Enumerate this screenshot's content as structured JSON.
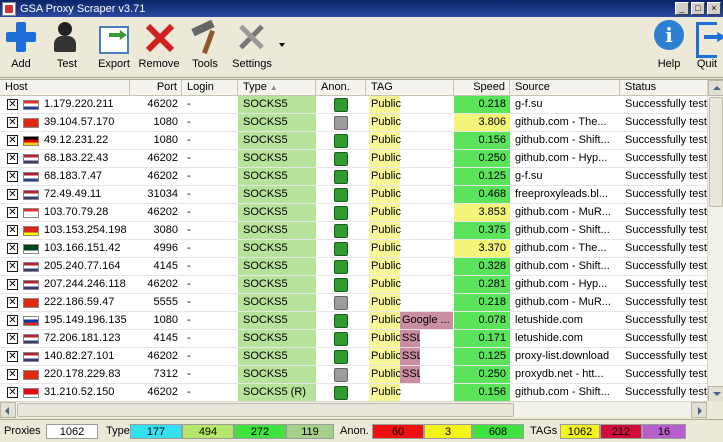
{
  "window": {
    "title": "GSA Proxy Scraper v3.71",
    "buttons": [
      "_",
      "□",
      "×"
    ]
  },
  "toolbar": {
    "add": "Add",
    "test": "Test",
    "export": "Export",
    "remove": "Remove",
    "tools": "Tools",
    "settings": "Settings",
    "help": "Help",
    "quit": "Quit",
    "help_glyph": "i"
  },
  "columns": [
    "Host",
    "Port",
    "Login",
    "Type",
    "Anon.",
    "TAG",
    "Speed",
    "Source",
    "Status"
  ],
  "rows": [
    {
      "flag": [
        "#e03030",
        "#ffffff",
        "#2040a0"
      ],
      "host": "1.179.220.211",
      "port": "46202",
      "login": "-",
      "type": "SOCKS5",
      "anon": "green",
      "tag": "Public",
      "tag2": "",
      "speed": "0.218",
      "speed_color": "#5be35b",
      "source": "g-f.su",
      "status": "Successfully teste"
    },
    {
      "flag": [
        "#de2910",
        "#de2910",
        "#de2910"
      ],
      "host": "39.104.57.170",
      "port": "1080",
      "login": "-",
      "type": "SOCKS5",
      "anon": "gray",
      "tag": "Public",
      "tag2": "",
      "speed": "3.806",
      "speed_color": "#f5f57a",
      "source": "github.com - The...",
      "status": "Successfully teste"
    },
    {
      "flag": [
        "#000000",
        "#dd0000",
        "#ffce00"
      ],
      "host": "49.12.231.22",
      "port": "1080",
      "login": "-",
      "type": "SOCKS5",
      "anon": "green",
      "tag": "Public",
      "tag2": "",
      "speed": "0.156",
      "speed_color": "#5be35b",
      "source": "github.com - Shift...",
      "status": "Successfully teste"
    },
    {
      "flag": [
        "#b22234",
        "#ffffff",
        "#3c3b6e"
      ],
      "host": "68.183.22.43",
      "port": "46202",
      "login": "-",
      "type": "SOCKS5",
      "anon": "green",
      "tag": "Public",
      "tag2": "",
      "speed": "0.250",
      "speed_color": "#5be35b",
      "source": "github.com - Hyp...",
      "status": "Successfully teste"
    },
    {
      "flag": [
        "#ae1c28",
        "#ffffff",
        "#21468b"
      ],
      "host": "68.183.7.47",
      "port": "46202",
      "login": "-",
      "type": "SOCKS5",
      "anon": "green",
      "tag": "Public",
      "tag2": "",
      "speed": "0.125",
      "speed_color": "#5be35b",
      "source": "g-f.su",
      "status": "Successfully teste"
    },
    {
      "flag": [
        "#b22234",
        "#ffffff",
        "#3c3b6e"
      ],
      "host": "72.49.49.11",
      "port": "31034",
      "login": "-",
      "type": "SOCKS5",
      "anon": "green",
      "tag": "Public",
      "tag2": "",
      "speed": "0.468",
      "speed_color": "#5be35b",
      "source": "freeproxyleads.bl...",
      "status": "Successfully teste"
    },
    {
      "flag": [
        "#e03030",
        "#ffffff",
        "#ffffff"
      ],
      "host": "103.70.79.28",
      "port": "46202",
      "login": "-",
      "type": "SOCKS5",
      "anon": "green",
      "tag": "Public",
      "tag2": "",
      "speed": "3.853",
      "speed_color": "#f5f57a",
      "source": "github.com - MuR...",
      "status": "Successfully teste"
    },
    {
      "flag": [
        "#da251d",
        "#da251d",
        "#ffff00"
      ],
      "host": "103.153.254.198",
      "port": "3080",
      "login": "-",
      "type": "SOCKS5",
      "anon": "green",
      "tag": "Public",
      "tag2": "",
      "speed": "0.375",
      "speed_color": "#5be35b",
      "source": "github.com - Shift...",
      "status": "Successfully teste"
    },
    {
      "flag": [
        "#01411c",
        "#01411c",
        "#ffffff"
      ],
      "host": "103.166.151.42",
      "port": "4996",
      "login": "-",
      "type": "SOCKS5",
      "anon": "green",
      "tag": "Public",
      "tag2": "",
      "speed": "3.370",
      "speed_color": "#f5f57a",
      "source": "github.com - The...",
      "status": "Successfully teste"
    },
    {
      "flag": [
        "#b22234",
        "#ffffff",
        "#3c3b6e"
      ],
      "host": "205.240.77.164",
      "port": "4145",
      "login": "-",
      "type": "SOCKS5",
      "anon": "green",
      "tag": "Public",
      "tag2": "",
      "speed": "0.328",
      "speed_color": "#5be35b",
      "source": "github.com - Shift...",
      "status": "Successfully teste"
    },
    {
      "flag": [
        "#b22234",
        "#ffffff",
        "#3c3b6e"
      ],
      "host": "207.244.246.118",
      "port": "46202",
      "login": "-",
      "type": "SOCKS5",
      "anon": "green",
      "tag": "Public",
      "tag2": "",
      "speed": "0.281",
      "speed_color": "#5be35b",
      "source": "github.com - Hyp...",
      "status": "Successfully teste"
    },
    {
      "flag": [
        "#de2910",
        "#de2910",
        "#de2910"
      ],
      "host": "222.186.59.47",
      "port": "5555",
      "login": "-",
      "type": "SOCKS5",
      "anon": "gray",
      "tag": "Public",
      "tag2": "",
      "speed": "0.218",
      "speed_color": "#5be35b",
      "source": "github.com - MuR...",
      "status": "Successfully teste"
    },
    {
      "flag": [
        "#ffffff",
        "#0039a6",
        "#d52b1e"
      ],
      "host": "195.149.196.135",
      "port": "1080",
      "login": "-",
      "type": "SOCKS5",
      "anon": "green",
      "tag": "Public",
      "tag2": "Google ...",
      "speed": "0.078",
      "speed_color": "#5be35b",
      "source": "letushide.com",
      "status": "Successfully teste"
    },
    {
      "flag": [
        "#b22234",
        "#ffffff",
        "#3c3b6e"
      ],
      "host": "72.206.181.123",
      "port": "4145",
      "login": "-",
      "type": "SOCKS5",
      "anon": "green",
      "tag": "Public",
      "tag2": "SSL",
      "speed": "0.171",
      "speed_color": "#5be35b",
      "source": "letushide.com",
      "status": "Successfully teste"
    },
    {
      "flag": [
        "#b22234",
        "#ffffff",
        "#3c3b6e"
      ],
      "host": "140.82.27.101",
      "port": "46202",
      "login": "-",
      "type": "SOCKS5",
      "anon": "green",
      "tag": "Public",
      "tag2": "SSL",
      "speed": "0.125",
      "speed_color": "#5be35b",
      "source": "proxy-list.download",
      "status": "Successfully teste"
    },
    {
      "flag": [
        "#de2910",
        "#de2910",
        "#de2910"
      ],
      "host": "220.178.229.83",
      "port": "7312",
      "login": "-",
      "type": "SOCKS5",
      "anon": "gray",
      "tag": "Public",
      "tag2": "SSL",
      "speed": "0.250",
      "speed_color": "#5be35b",
      "source": "proxydb.net - htt...",
      "status": "Successfully teste"
    },
    {
      "flag": [
        "#e30a17",
        "#e30a17",
        "#ffffff"
      ],
      "host": "31.210.52.150",
      "port": "46202",
      "login": "-",
      "type": "SOCKS5 (R)",
      "anon": "green",
      "tag": "Public",
      "tag2": "",
      "speed": "0.156",
      "speed_color": "#5be35b",
      "source": "github.com - Shift...",
      "status": "Successfully teste"
    }
  ],
  "status": {
    "proxies_label": "Proxies",
    "proxies_count": "1062",
    "type_label": "Type",
    "type_counts": [
      {
        "value": "177",
        "color": "#33e0f0"
      },
      {
        "value": "494",
        "color": "#b5e86a"
      },
      {
        "value": "272",
        "color": "#3fe33f"
      },
      {
        "value": "119",
        "color": "#a6cf8a"
      }
    ],
    "anon_label": "Anon.",
    "anon_counts": [
      {
        "value": "60",
        "color": "#ee1111"
      },
      {
        "value": "3",
        "color": "#f4f41a"
      },
      {
        "value": "608",
        "color": "#3fe33f"
      }
    ],
    "tags_label": "TAGs",
    "tag_counts": [
      {
        "value": "1062",
        "color": "#f4f41a"
      },
      {
        "value": "212",
        "color": "#d10d3c"
      },
      {
        "value": "16",
        "color": "#b85fd0"
      }
    ]
  }
}
